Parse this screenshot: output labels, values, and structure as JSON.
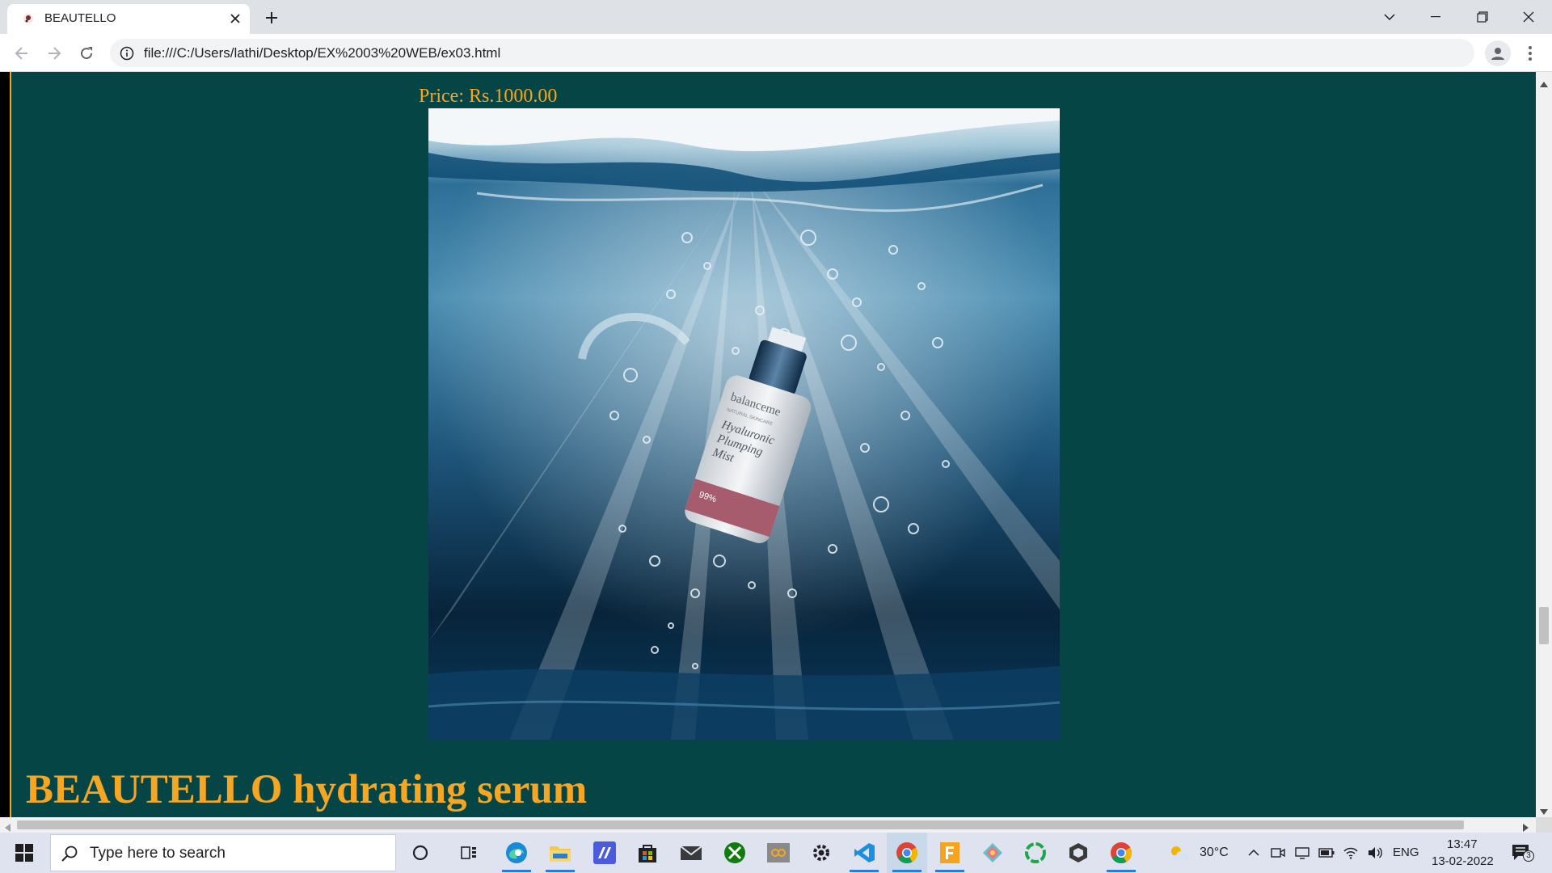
{
  "browser": {
    "tab": {
      "title": "BEAUTELLO",
      "favicon": "beautello-favicon-icon"
    },
    "url": "file:///C:/Users/lathi/Desktop/EX%2003%20WEB/ex03.html"
  },
  "page": {
    "price": "Price: Rs.1000.00",
    "product_name": "BEAUTELLO hydrating serum",
    "image": {
      "bottle_brand": "balanceme",
      "bottle_subbrand": "NATURAL SKINCARE",
      "bottle_line1": "Hyaluronic",
      "bottle_line2": "Plumping",
      "bottle_line3": "Mist",
      "bottle_badge": "99%"
    },
    "colors": {
      "background": "#054545",
      "accent": "#f5a623"
    }
  },
  "taskbar": {
    "search_placeholder": "Type here to search",
    "apps": [
      "task-view",
      "edge",
      "file-explorer",
      "visual-studio-purple",
      "microsoft-store",
      "mail",
      "xbox",
      "photos",
      "settings",
      "vscode",
      "chrome",
      "foxit",
      "gitkraken",
      "circle-app",
      "unity",
      "chrome"
    ],
    "weather": "30°C",
    "language": "ENG",
    "time": "13:47",
    "date": "13-02-2022",
    "notification_count": "3"
  }
}
